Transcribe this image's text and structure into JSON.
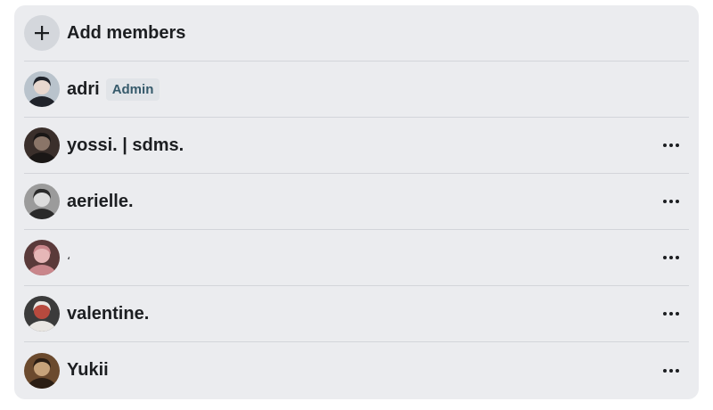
{
  "add_members": {
    "label": "Add members",
    "icon": "plus-icon"
  },
  "admin_badge": "Admin",
  "members": [
    {
      "name": "adri",
      "is_admin": true,
      "avatar_colors": [
        "#b9c3cc",
        "#20232a",
        "#e8d8cf"
      ]
    },
    {
      "name": "yossi. | sdms.",
      "is_admin": false,
      "avatar_colors": [
        "#3a2f2b",
        "#1a1716",
        "#8a7568"
      ]
    },
    {
      "name": "aerielle.",
      "is_admin": false,
      "avatar_colors": [
        "#9b9b9b",
        "#2a2a2a",
        "#dcdcdc"
      ]
    },
    {
      "name": "،",
      "is_admin": false,
      "avatar_colors": [
        "#5a3a3a",
        "#c9868b",
        "#e6b7b7"
      ]
    },
    {
      "name": "valentine.",
      "is_admin": false,
      "avatar_colors": [
        "#3b3b3b",
        "#e9e6e2",
        "#b84a3e"
      ]
    },
    {
      "name": "Yukii",
      "is_admin": false,
      "avatar_colors": [
        "#6b4a2e",
        "#2b1e14",
        "#c7a37a"
      ]
    }
  ],
  "more_icon": "more-horizontal-icon"
}
